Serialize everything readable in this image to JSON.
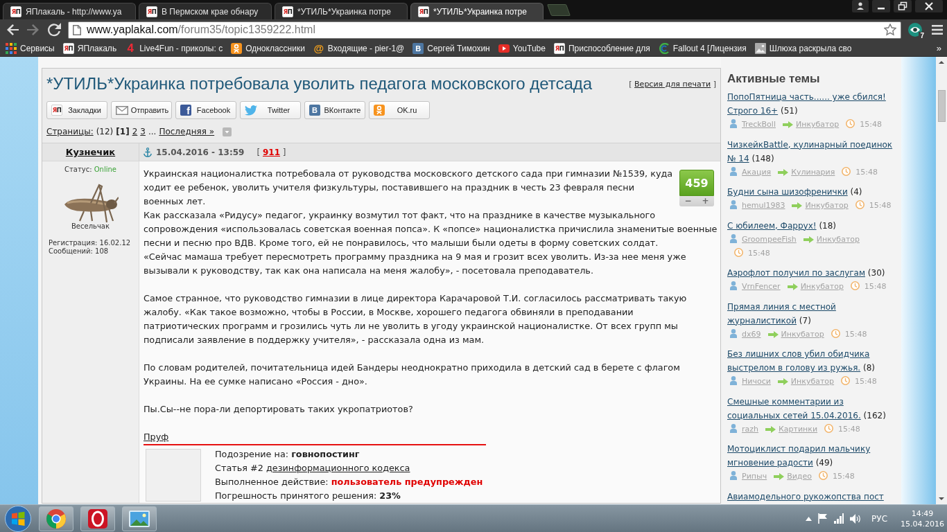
{
  "browser": {
    "tabs": [
      {
        "title": "ЯПлакаль - http://www.ya",
        "logo": "ЯП",
        "selected": false
      },
      {
        "title": "В Пермском крае обнару",
        "logo": "ЯП",
        "selected": false
      },
      {
        "title": "*УТИЛЬ*Украинка потре",
        "logo": "ЯП",
        "selected": false
      },
      {
        "title": "*УТИЛЬ*Украинка потре",
        "logo": "ЯП",
        "selected": true
      }
    ],
    "address": {
      "domain": "www.yaplakal.com",
      "path": "/forum35/topic1359222.html"
    },
    "extension_badge": "7",
    "bookmarks": [
      {
        "label": "Сервисы",
        "kind": "apps"
      },
      {
        "label": "ЯПлакаль",
        "kind": "yp",
        "logo": "ЯП"
      },
      {
        "label": "Live4Fun - приколы: с",
        "kind": "four",
        "logo": "4"
      },
      {
        "label": "Одноклассники",
        "kind": "ok"
      },
      {
        "label": "Входящие - pier-1@",
        "kind": "mail",
        "logo": "@"
      },
      {
        "label": "Сергей Тимохин",
        "kind": "vk",
        "logo": "В"
      },
      {
        "label": "YouTube",
        "kind": "youtube"
      },
      {
        "label": "Приспособление для",
        "kind": "yp",
        "logo": "ЯП"
      },
      {
        "label": "Fallout 4 [Лицензия",
        "kind": "swirl"
      },
      {
        "label": "Шлюха раскрыла сво",
        "kind": "picture"
      }
    ],
    "bookmarks_more": "»"
  },
  "post": {
    "title": "*УТИЛЬ*Украинка потребовала уволить педагога московского детсада",
    "print_link": {
      "before": "[",
      "label": "Версия для печати",
      "after": "]"
    },
    "share_buttons": [
      {
        "label": "Закладки",
        "kind": "yp",
        "logo": "ЯП"
      },
      {
        "label": "Отправить",
        "kind": "mail"
      },
      {
        "label": "Facebook",
        "kind": "facebook",
        "logo": "f"
      },
      {
        "label": "Twitter",
        "kind": "twitter"
      },
      {
        "label": "ВКонтакте",
        "kind": "vk",
        "logo": "В"
      },
      {
        "label": "OK.ru",
        "kind": "ok"
      }
    ],
    "pagination": {
      "label": "Страницы:",
      "count": "(12)",
      "pages": [
        {
          "label": "[1]",
          "selected": true
        },
        {
          "label": "2",
          "selected": false
        },
        {
          "label": "3",
          "selected": false
        }
      ],
      "ellipsis": "...",
      "last": "Последняя »"
    },
    "author": {
      "name": "Кузнечик",
      "status_label": "Статус:",
      "status": "Online",
      "rank": "Весельчак",
      "registered": "Регистрация: 16.02.12",
      "posts": "Сообщений: 108"
    },
    "date": "15.04.2016 - 13:59",
    "number": {
      "before": "[",
      "value": "911",
      "after": "]"
    },
    "rating": {
      "value": "459",
      "minus": "−",
      "plus": "+"
    },
    "body": [
      [
        "Украинская националистка потребовала от руководства московского детского сада при гимназии №1539, куда ходит ее ребенок, уволить учителя физкультуры, поставившего на праздник в честь 23 февраля песни\nвоенных лет.",
        "Как рассказала «Ридусу» педагог, украинку возмутил тот факт, что на празднике в качестве музыкального сопровождения «использовалась советская военная попса». К «попсе» националистка причислила знаменитые военные песни и песню про ВДВ. Кроме того, ей не понравилось, что малыши были одеты в форму советских солдат.",
        "«Сейчас мамаша требует пересмотреть программу праздника на 9 мая и грозит всех уволить. Из-за нее меня уже вызывали к руководству, так как она написала на меня жалобу», - посетовала преподаватель."
      ],
      [
        "Самое странное, что руководство гимназии в лице директора Карачаровой Т.И. согласилось рассматривать такую жалобу. «Как такое возможно, чтобы в России, в Москве, хорошего педагога обвиняли в преподавании\nпатриотических программ и грозились чуть ли не уволить в угоду украинской националистке. От всех групп мы подписали заявление в поддержку учителя», - рассказала одна из мам."
      ],
      [
        "По словам родителей, почитательница идей Бандеры неоднократно приходила в детский сад в берете с флагом Украины. На ее сумке написано «Россия - дно»."
      ],
      [
        "Пы.Сы--не пора-ли депортировать таких укропатриотов?"
      ]
    ],
    "proof_link": "Пруф",
    "moderation": [
      {
        "kind": "bold",
        "label": "Подозрение на:",
        "value": "говнопостинг"
      },
      {
        "kind": "link",
        "label": "Статья #2",
        "value": "дезинформационного кодекса"
      },
      {
        "kind": "alert",
        "label": "Выполненное действие:",
        "value": "пользователь предупрежден"
      },
      {
        "kind": "bold",
        "label": "Погрешность принятого решения:",
        "value": "23%"
      }
    ]
  },
  "sidebar": {
    "title": "Активные темы",
    "topics": [
      {
        "title": "ПопоПятница часть...... уже сбился! Строго 16+",
        "count": "(51)",
        "user": "TreckBoll",
        "section": "Инкубатор",
        "time": "15:48"
      },
      {
        "title": "ЧизкейкBattle, кулинарный поединок № 14",
        "count": "(148)",
        "user": "Акация",
        "section": "Кулинария",
        "time": "15:48"
      },
      {
        "title": "Будни сына шизофренички",
        "count": "(4)",
        "user": "hemul1983",
        "section": "Инкубатор",
        "time": "15:48"
      },
      {
        "title": "С юбилеем, Фаррух!",
        "count": "(18)",
        "user": "GroompeeFish",
        "section": "Инкубатор",
        "time": "15:48"
      },
      {
        "title": "Аэрофлот получил по заслугам",
        "count": "(30)",
        "user": "VrnFencer",
        "section": "Инкубатор",
        "time": "15:48"
      },
      {
        "title": "Прямая линия с местной журналистикой",
        "count": "(7)",
        "user": "dx69",
        "section": "Инкубатор",
        "time": "15:48"
      },
      {
        "title": "Без лишних слов убил обидчика выстрелом в голову из ружья.",
        "count": "(8)",
        "user": "Ничоси",
        "section": "Инкубатор",
        "time": "15:48"
      },
      {
        "title": "Смешные комментарии из социальных сетей 15.04.2016.",
        "count": "(162)",
        "user": "razh",
        "section": "Картинки",
        "time": "15:48"
      },
      {
        "title": "Мотоциклист подарил мальчику мгновение радости",
        "count": "(49)",
        "user": "Рипыч",
        "section": "Видео",
        "time": "15:48"
      },
      {
        "title": "Авиамодельного рукожопства пост"
      }
    ]
  },
  "taskbar": {
    "apps": [
      {
        "kind": "chrome"
      },
      {
        "kind": "opera"
      },
      {
        "kind": "photos"
      }
    ],
    "language": "РУС",
    "time": "14:49",
    "date": "15.04.2016"
  }
}
